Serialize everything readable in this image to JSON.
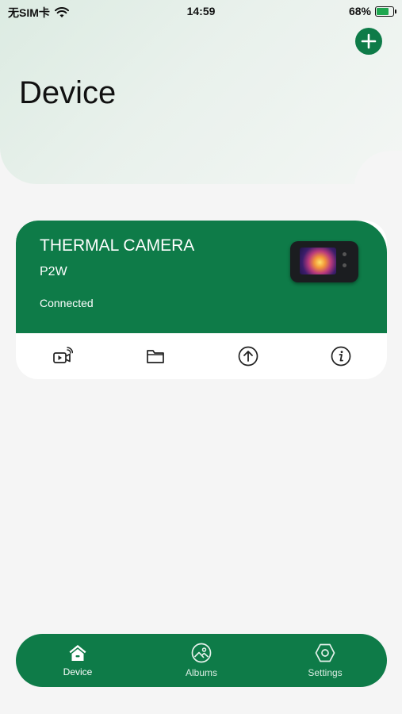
{
  "status_bar": {
    "carrier": "无SIM卡",
    "time": "14:59",
    "battery": "68%",
    "battery_level": 0.68
  },
  "header": {
    "title": "Device",
    "add_icon": "plus-icon"
  },
  "device_card": {
    "name": "THERMAL CAMERA",
    "model": "P2W",
    "status": "Connected",
    "actions": [
      {
        "icon": "live-video-icon"
      },
      {
        "icon": "folder-icon"
      },
      {
        "icon": "upload-icon"
      },
      {
        "icon": "info-icon"
      }
    ]
  },
  "bottom_nav": {
    "items": [
      {
        "label": "Device",
        "icon": "home-icon",
        "active": true
      },
      {
        "label": "Albums",
        "icon": "albums-icon",
        "active": false
      },
      {
        "label": "Settings",
        "icon": "settings-icon",
        "active": false
      }
    ]
  },
  "colors": {
    "brand": "#0e7b48",
    "background": "#f5f5f5"
  }
}
